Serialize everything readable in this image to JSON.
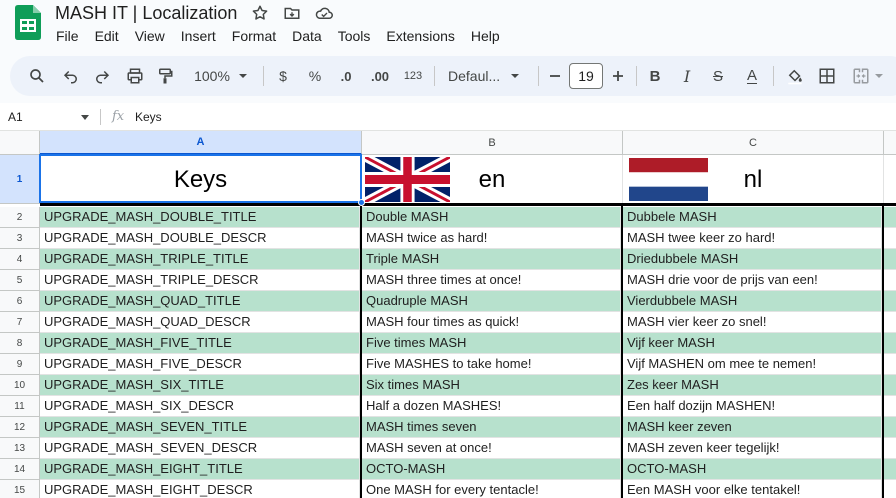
{
  "app": {
    "title": "MASH IT | Localization",
    "menu": [
      "File",
      "Edit",
      "View",
      "Insert",
      "Format",
      "Data",
      "Tools",
      "Extensions",
      "Help"
    ]
  },
  "toolbar": {
    "zoom": "100%",
    "currency": "$",
    "percent": "%",
    "decrease_decimal": ".0",
    "increase_decimal": ".00",
    "number_format": "123",
    "font": "Defaul...",
    "font_size": "19",
    "bold": "B",
    "italic": "I",
    "strikethrough": "S",
    "text_color": "A"
  },
  "formula_bar": {
    "cell_ref": "A1",
    "fx": "fx",
    "content": "Keys"
  },
  "grid": {
    "columns": [
      "A",
      "B",
      "C"
    ],
    "header_row": {
      "number": "1",
      "cells": [
        "Keys",
        "en",
        "nl"
      ]
    },
    "rows": [
      {
        "n": "2",
        "key": "UPGRADE_MASH_DOUBLE_TITLE",
        "en": "Double MASH",
        "nl": "Dubbele MASH"
      },
      {
        "n": "3",
        "key": "UPGRADE_MASH_DOUBLE_DESCR",
        "en": "MASH twice as hard!",
        "nl": "MASH twee keer zo hard!"
      },
      {
        "n": "4",
        "key": "UPGRADE_MASH_TRIPLE_TITLE",
        "en": "Triple MASH",
        "nl": "Driedubbele MASH"
      },
      {
        "n": "5",
        "key": "UPGRADE_MASH_TRIPLE_DESCR",
        "en": "MASH three times at once!",
        "nl": "MASH drie voor de prijs van een!"
      },
      {
        "n": "6",
        "key": "UPGRADE_MASH_QUAD_TITLE",
        "en": "Quadruple MASH",
        "nl": "Vierdubbele MASH"
      },
      {
        "n": "7",
        "key": "UPGRADE_MASH_QUAD_DESCR",
        "en": "MASH four times as quick!",
        "nl": "MASH vier keer zo snel!"
      },
      {
        "n": "8",
        "key": "UPGRADE_MASH_FIVE_TITLE",
        "en": "Five times MASH",
        "nl": "Vijf keer MASH"
      },
      {
        "n": "9",
        "key": "UPGRADE_MASH_FIVE_DESCR",
        "en": "Five MASHES to take home!",
        "nl": "Vijf MASHEN om mee te nemen!"
      },
      {
        "n": "10",
        "key": "UPGRADE_MASH_SIX_TITLE",
        "en": "Six times MASH",
        "nl": "Zes keer MASH"
      },
      {
        "n": "11",
        "key": "UPGRADE_MASH_SIX_DESCR",
        "en": "Half a dozen MASHES!",
        "nl": "Een half dozijn MASHEN!"
      },
      {
        "n": "12",
        "key": "UPGRADE_MASH_SEVEN_TITLE",
        "en": "MASH times seven",
        "nl": "MASH keer zeven"
      },
      {
        "n": "13",
        "key": "UPGRADE_MASH_SEVEN_DESCR",
        "en": "MASH seven at once!",
        "nl": "MASH zeven keer tegelijk!"
      },
      {
        "n": "14",
        "key": "UPGRADE_MASH_EIGHT_TITLE",
        "en": "OCTO-MASH",
        "nl": "OCTO-MASH"
      },
      {
        "n": "15",
        "key": "UPGRADE_MASH_EIGHT_DESCR",
        "en": "One MASH for every tentacle!",
        "nl": "Een MASH voor elke tentakel!"
      }
    ]
  },
  "colors": {
    "title_row_fill": "#b7e1cd",
    "selection": "#1a73e8",
    "sheets_green": "#0f9d58"
  }
}
